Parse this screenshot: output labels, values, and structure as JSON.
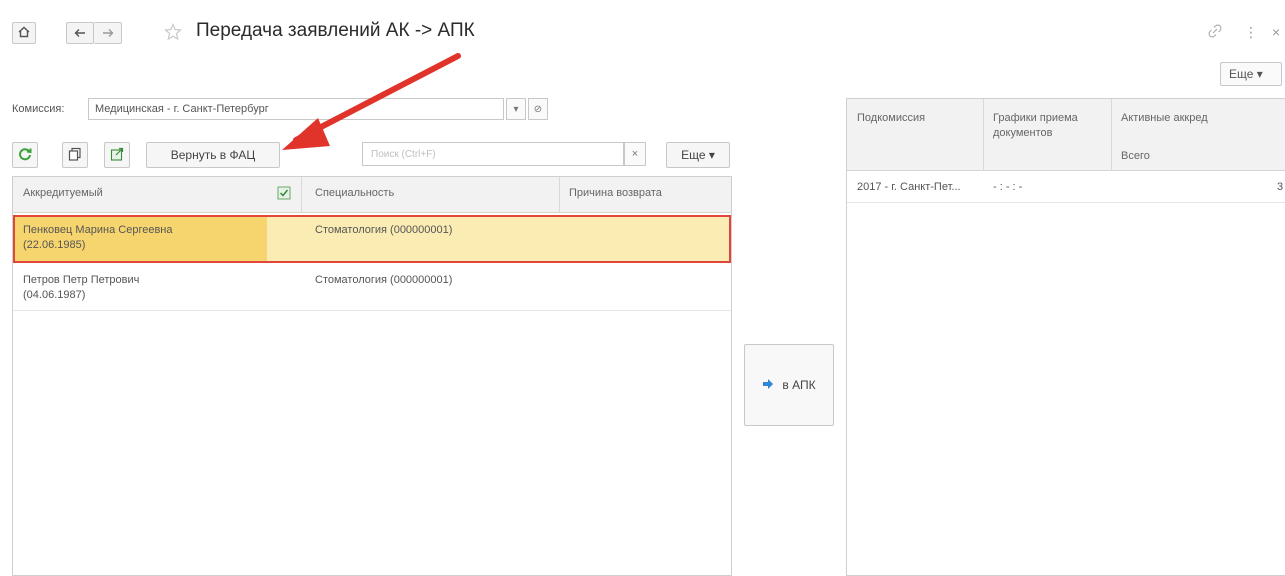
{
  "header": {
    "home_icon": "home-icon",
    "back_icon": "arrow-left-icon",
    "forward_icon": "arrow-right-icon",
    "favorite_icon": "star-icon",
    "title": "Передача заявлений АК -> АПК",
    "link_icon": "link-icon",
    "menu_icon": "vertical-dots-icon",
    "close_icon": "close-icon",
    "more_label": "Еще ▾"
  },
  "commission": {
    "label": "Комиссия:",
    "value": "Медицинская - г. Санкт-Петербург",
    "dropdown_symbol": "▾",
    "open_symbol": "⊘"
  },
  "toolbar": {
    "refresh_icon": "refresh-icon",
    "copy_icon": "copy-icon",
    "export_icon": "export-icon",
    "return_label": "Вернуть в ФАЦ",
    "search_placeholder": "Поиск (Ctrl+F)",
    "search_clear": "×",
    "more_label": "Еще ▾"
  },
  "left_table": {
    "columns": [
      "Аккредитуемый",
      "Специальность",
      "Причина возврата"
    ],
    "column_icon": "checklist-icon",
    "rows": [
      {
        "name": "Пенковец Марина Сергеевна",
        "dob": "(22.06.1985)",
        "specialty": "Стоматология (000000001)",
        "reason": "",
        "selected": true
      },
      {
        "name": "Петров Петр Петрович",
        "dob": "(04.06.1987)",
        "specialty": "Стоматология (000000001)",
        "reason": "",
        "selected": false
      }
    ]
  },
  "move": {
    "icon": "arrow-right-icon",
    "label": "в АПК"
  },
  "right_table": {
    "columns": [
      "Подкомиссия",
      "Графики приема документов",
      "Активные аккред"
    ],
    "subheader": "Всего",
    "rows": [
      {
        "subcommission": "2017 - г. Санкт-Пет...",
        "schedule": "- : - : -",
        "total": "3"
      }
    ]
  },
  "annotation": {
    "arrow_color": "#e0332a",
    "selection_border": "#e2463a",
    "selection_fill": "#fbecb3"
  }
}
